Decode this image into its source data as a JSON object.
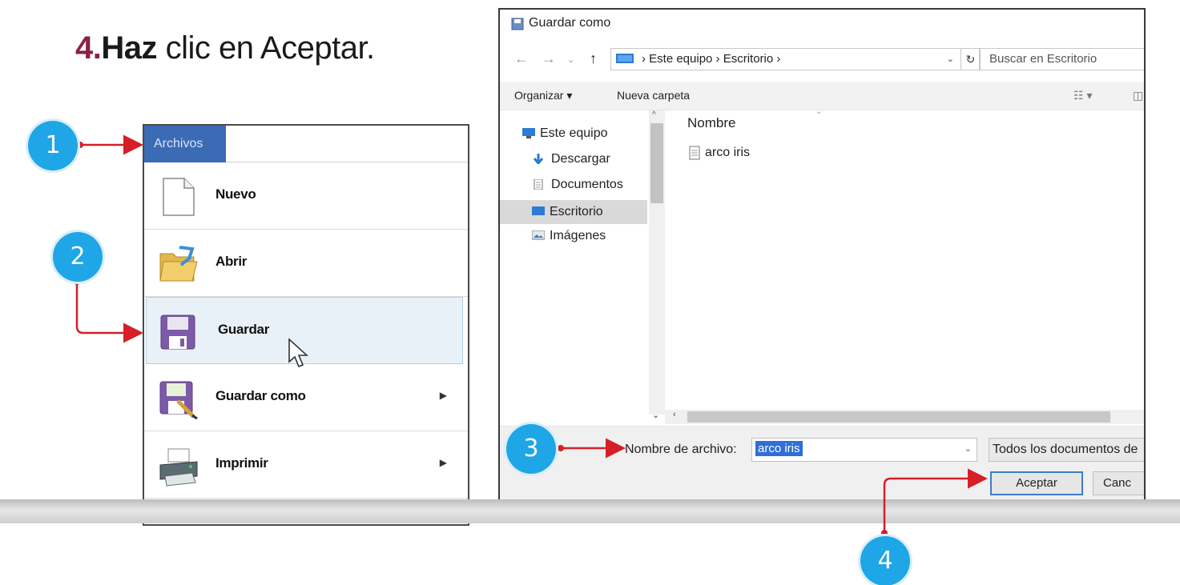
{
  "instruction": {
    "number": "4.",
    "verb": "Haz",
    "rest": "clic en Aceptar."
  },
  "badges": [
    "1",
    "2",
    "3",
    "4"
  ],
  "file_menu": {
    "tab": "Archivos",
    "items": [
      {
        "label": "Nuevo",
        "icon": "new-document-icon"
      },
      {
        "label": "Abrir",
        "icon": "open-folder-icon"
      },
      {
        "label": "Guardar",
        "icon": "save-icon"
      },
      {
        "label": "Guardar como",
        "icon": "save-as-icon"
      },
      {
        "label": "Imprimir",
        "icon": "printer-icon"
      }
    ]
  },
  "dialog": {
    "title": "Guardar como",
    "path": "› Este equipo › Escritorio ›",
    "search_placeholder": "Buscar en Escritorio",
    "toolbar": {
      "organize": "Organizar ▾",
      "new_folder": "Nueva carpeta"
    },
    "nav": [
      "Este equipo",
      "Descargar",
      "Documentos",
      "Escritorio",
      "Imágenes"
    ],
    "column_header": "Nombre",
    "files": [
      "arco iris"
    ],
    "filename_label": "Nombre de archivo:",
    "filename_value": "arco iris",
    "filetype": "Todos los documentos de",
    "accept": "Aceptar",
    "cancel": "Canc"
  },
  "colors": {
    "badge": "#1fa6e6",
    "arrow": "#d61f26",
    "accent": "#3b6bb5",
    "number": "#8a2145"
  }
}
